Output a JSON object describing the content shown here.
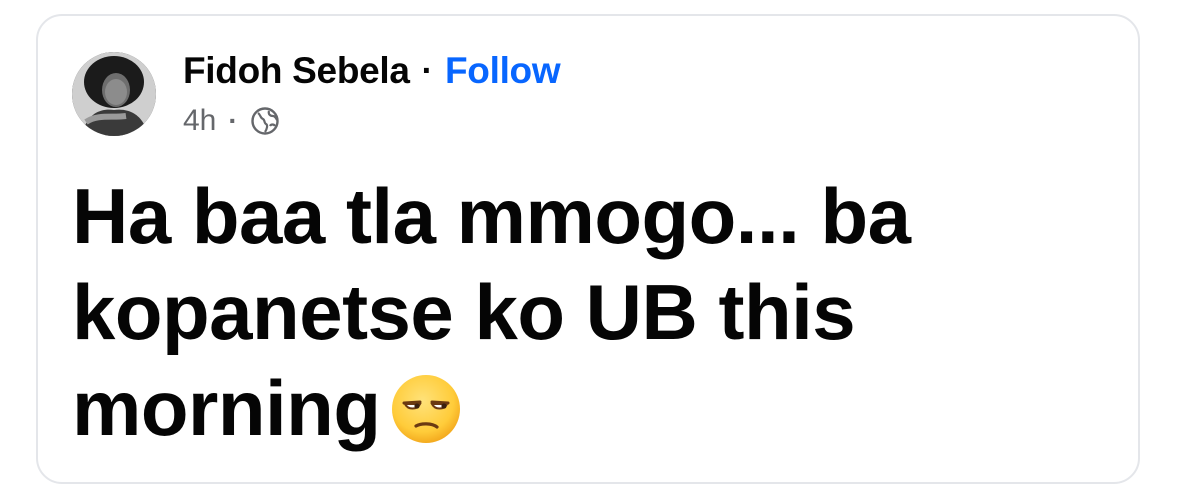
{
  "post": {
    "author_name": "Fidoh Sebela",
    "separator": "·",
    "follow_label": "Follow",
    "timestamp": "4h",
    "meta_separator": "·",
    "privacy_icon": "globe-icon",
    "text_lines": [
      "Ha baa tla mmogo... ba",
      "kopanetse ko UB this",
      "morning"
    ],
    "emoji": "unamused-face-emoji"
  },
  "colors": {
    "follow_link": "#0866ff",
    "name_text": "#050505",
    "meta_text": "#65676b",
    "card_border": "#e4e6ea",
    "emoji_face": "#ffcc3a"
  }
}
